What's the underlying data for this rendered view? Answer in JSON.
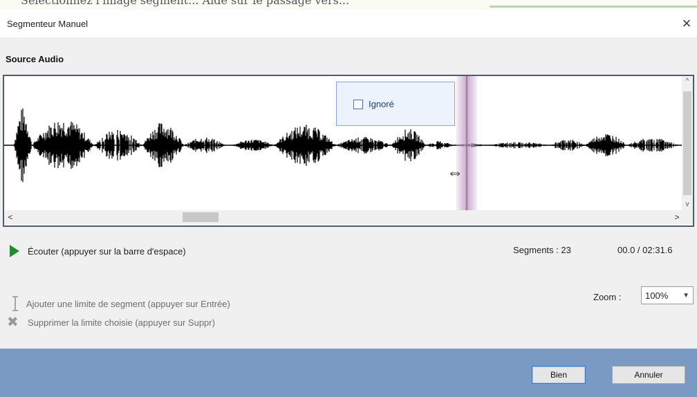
{
  "top_fragment": "Sélectionnez l'image segment... Aide sur le passage vers...",
  "window": {
    "title": "Segmenteur Manuel",
    "close_glyph": "×"
  },
  "section": {
    "title": "Source Audio"
  },
  "waveform": {
    "segment_checkbox_label": "Ignoré",
    "segment_checkbox_checked": false,
    "h_scroll_left_glyph": "<",
    "h_scroll_right_glyph": ">",
    "v_scroll_up_glyph": "^",
    "v_scroll_down_glyph": "v"
  },
  "controls": {
    "play_label": "Écouter (appuyer sur la barre d'espace)",
    "add_boundary_label": "Ajouter une limite de segment (appuyer sur Entrée)",
    "delete_boundary_label": "Supprimer la limite choisie (appuyer sur Suppr)"
  },
  "status": {
    "segments_label": "Segments : 23",
    "time_readout": "00.0 / 02:31.6"
  },
  "zoom": {
    "label": "Zoom :",
    "value": "100%"
  },
  "buttons": {
    "ok_label": "Bien",
    "cancel_label": "Annuler"
  },
  "colors": {
    "play_icon": "#228b2d",
    "footer_background": "#7b9ac3",
    "segment_marker": "#a05a78",
    "ignore_box_background": "#ecf3fd"
  },
  "icons": {
    "play": "play-icon",
    "add_boundary": "text-cursor-icon",
    "delete_boundary": "delete-x-icon",
    "resize": "resize-horizontal-icon"
  }
}
